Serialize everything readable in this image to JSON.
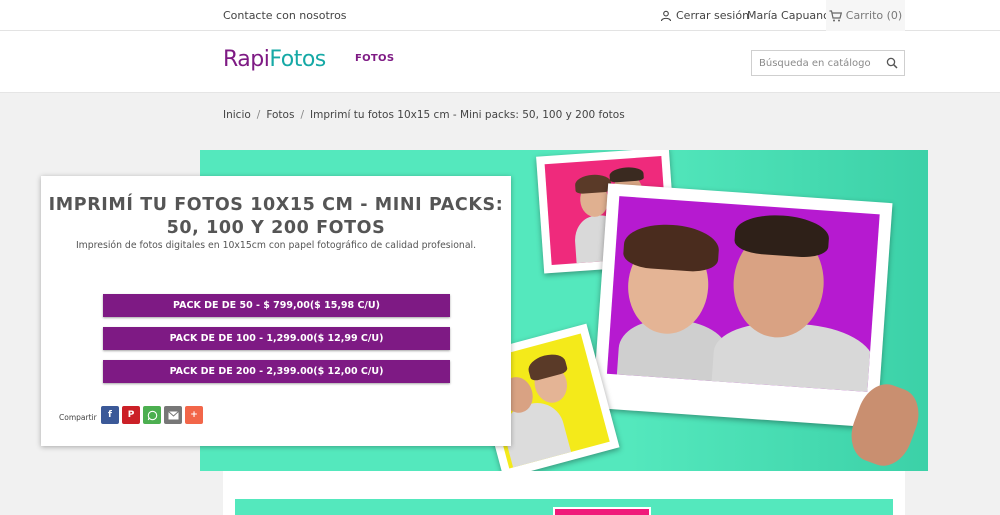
{
  "topbar": {
    "contact": "Contacte con nosotros",
    "logout": "Cerrar sesión",
    "user": "María Capuano",
    "cart": "Carrito (0)"
  },
  "header": {
    "logo_part1": "Rapi",
    "logo_part2": "Fotos",
    "nav_item": "FOTOS",
    "search_placeholder": "Búsqueda en catálogo"
  },
  "breadcrumb": {
    "items": [
      "Inicio",
      "Fotos",
      "Imprimí tu fotos 10x15 cm - Mini packs: 50, 100 y 200 fotos"
    ],
    "separator": "/"
  },
  "product": {
    "title_line1": "IMPRIMÍ TU FOTOS 10X15 CM - MINI PACKS:",
    "title_line2": "50, 100 Y 200 FOTOS",
    "subtitle": "Impresión de fotos digitales en 10x15cm con papel fotográfico de calidad profesional.",
    "packs": [
      "PACK DE DE 50 - $ 799,00($ 15,98 C/U)",
      "PACK DE DE 100 - 1,299.00($ 12,99 C/U)",
      "PACK DE DE 200 - 2,399.00($ 12,00 C/U)"
    ],
    "share_label": "Compartir",
    "share_buttons": [
      {
        "icon": "facebook-icon",
        "glyph": "f",
        "color": "#3b5998"
      },
      {
        "icon": "pinterest-icon",
        "glyph": "P",
        "color": "#cb2027"
      },
      {
        "icon": "whatsapp-icon",
        "glyph": "",
        "color": "#4caf50"
      },
      {
        "icon": "email-icon",
        "glyph": "",
        "color": "#777777"
      },
      {
        "icon": "more-icon",
        "glyph": "+",
        "color": "#f26649"
      }
    ]
  },
  "colors": {
    "brand_purple": "#7e1a84",
    "brand_teal": "#16a9a6",
    "hero_green": "#54e8bd"
  }
}
